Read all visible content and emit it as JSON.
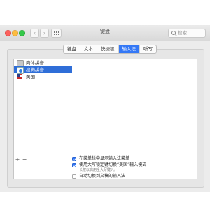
{
  "window": {
    "title": "键盘",
    "search_placeholder": "搜索"
  },
  "tabs": [
    {
      "label": "键盘",
      "active": false
    },
    {
      "label": "文本",
      "active": false
    },
    {
      "label": "快捷键",
      "active": false
    },
    {
      "label": "输入法",
      "active": true
    },
    {
      "label": "听写",
      "active": false
    }
  ],
  "input_sources": [
    {
      "label": "简体拼音",
      "icon": "pinyin-icon",
      "selected": false
    },
    {
      "label": "搜狗拼音",
      "icon": "sogou-icon",
      "selected": true
    },
    {
      "label": "美国",
      "icon": "us-flag-icon",
      "selected": false
    }
  ],
  "list_controls": {
    "add": "+",
    "remove": "−"
  },
  "options": [
    {
      "label": "在菜单栏中显示输入法菜单",
      "checked": true
    },
    {
      "label": "使用大写锁定键切换“美国”输入模式",
      "checked": true,
      "note": "长按以启用全大写键入。"
    },
    {
      "label": "自动切换到文稿的输入法",
      "checked": false
    }
  ],
  "colors": {
    "accent": "#3478f6",
    "selection": "#2f6ed8"
  }
}
